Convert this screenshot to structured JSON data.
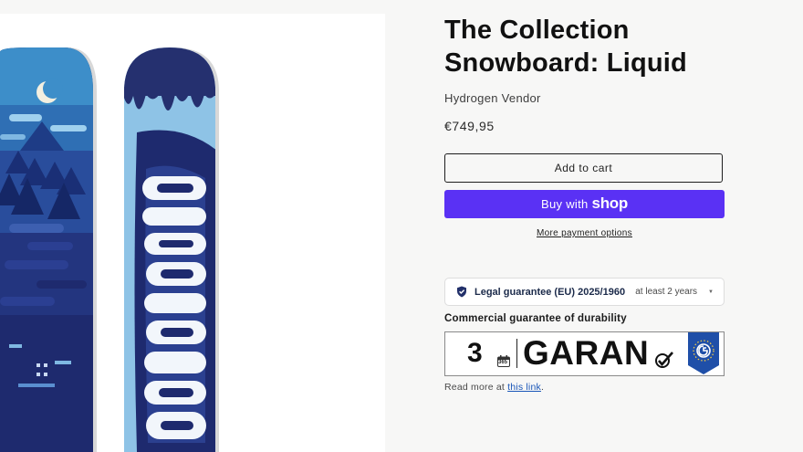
{
  "product": {
    "title": "The Collection Snowboard: Liquid",
    "vendor": "Hydrogen Vendor",
    "price": "€749,95",
    "image_alt": "Snowboard pair"
  },
  "actions": {
    "add_to_cart": "Add to cart",
    "buy_with": "Buy with",
    "shop_logo": "shop",
    "more_payment": "More payment options"
  },
  "guarantee": {
    "legal_label": "Legal guarantee (EU) 2025/1960",
    "legal_value": "at least 2 years",
    "caret": "▼",
    "commercial_title": "Commercial guarantee of durability",
    "badge_number": "3",
    "badge_word": "GARAN",
    "calendar_text": "365",
    "read_more_prefix": "Read more at ",
    "read_more_link": "this link",
    "read_more_suffix": "."
  },
  "colors": {
    "shop_purple": "#5a31f4",
    "link_blue": "#1a56b8",
    "board_dark": "#1f2a6b",
    "board_light": "#8ec3e6"
  }
}
